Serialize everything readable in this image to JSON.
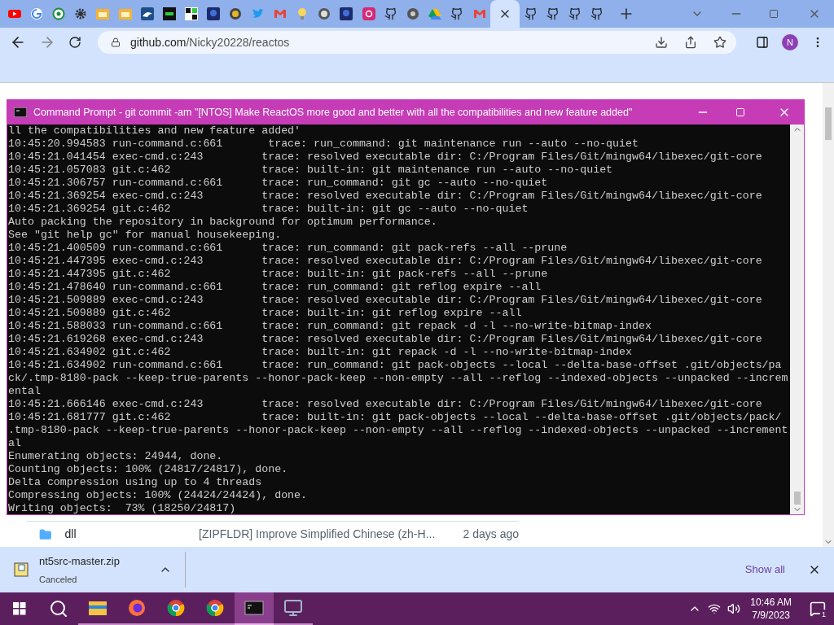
{
  "browser": {
    "tabs": [
      {
        "kind": "youtube",
        "selected": false
      },
      {
        "kind": "google",
        "selected": false
      },
      {
        "kind": "circle-green",
        "selected": false
      },
      {
        "kind": "gear",
        "selected": false
      },
      {
        "kind": "folder",
        "selected": false
      },
      {
        "kind": "folder",
        "selected": false
      },
      {
        "kind": "bird",
        "selected": false
      },
      {
        "kind": "kim",
        "selected": false
      },
      {
        "kind": "squares",
        "selected": false
      },
      {
        "kind": "game",
        "selected": false
      },
      {
        "kind": "circle-gold",
        "selected": false
      },
      {
        "kind": "twitter",
        "selected": false
      },
      {
        "kind": "gmail",
        "selected": false
      },
      {
        "kind": "bulb",
        "selected": false
      },
      {
        "kind": "circle-gray",
        "selected": false
      },
      {
        "kind": "game",
        "selected": false
      },
      {
        "kind": "instagram",
        "selected": false
      },
      {
        "kind": "github",
        "selected": false
      },
      {
        "kind": "chrome",
        "selected": false
      },
      {
        "kind": "drive",
        "selected": false
      },
      {
        "kind": "github",
        "selected": false
      },
      {
        "kind": "gmail",
        "selected": false
      },
      {
        "kind": "close",
        "selected": true
      },
      {
        "kind": "github",
        "selected": false
      },
      {
        "kind": "github",
        "selected": false
      },
      {
        "kind": "github",
        "selected": false
      },
      {
        "kind": "github",
        "selected": false
      }
    ],
    "address": {
      "host": "github.com",
      "path": "/Nicky20228/reactos"
    },
    "profile": "N"
  },
  "console": {
    "title": "Command Prompt - git  commit -am \"[NTOS] Make ReactOS more good and better with all the compatibilities and new feature added\"",
    "lines": [
      "ll the compatibilities and new feature added'",
      "10:45:20.994583 run-command.c:661       trace: run_command: git maintenance run --auto --no-quiet",
      "10:45:21.041454 exec-cmd.c:243         trace: resolved executable dir: C:/Program Files/Git/mingw64/libexec/git-core",
      "10:45:21.057083 git.c:462              trace: built-in: git maintenance run --auto --no-quiet",
      "10:45:21.306757 run-command.c:661      trace: run_command: git gc --auto --no-quiet",
      "10:45:21.369254 exec-cmd.c:243         trace: resolved executable dir: C:/Program Files/Git/mingw64/libexec/git-core",
      "10:45:21.369254 git.c:462              trace: built-in: git gc --auto --no-quiet",
      "Auto packing the repository in background for optimum performance.",
      "See \"git help gc\" for manual housekeeping.",
      "10:45:21.400509 run-command.c:661      trace: run_command: git pack-refs --all --prune",
      "10:45:21.447395 exec-cmd.c:243         trace: resolved executable dir: C:/Program Files/Git/mingw64/libexec/git-core",
      "10:45:21.447395 git.c:462              trace: built-in: git pack-refs --all --prune",
      "10:45:21.478640 run-command.c:661      trace: run_command: git reflog expire --all",
      "10:45:21.509889 exec-cmd.c:243         trace: resolved executable dir: C:/Program Files/Git/mingw64/libexec/git-core",
      "10:45:21.509889 git.c:462              trace: built-in: git reflog expire --all",
      "10:45:21.588033 run-command.c:661      trace: run_command: git repack -d -l --no-write-bitmap-index",
      "10:45:21.619268 exec-cmd.c:243         trace: resolved executable dir: C:/Program Files/Git/mingw64/libexec/git-core",
      "10:45:21.634902 git.c:462              trace: built-in: git repack -d -l --no-write-bitmap-index",
      "10:45:21.634902 run-command.c:661      trace: run_command: git pack-objects --local --delta-base-offset .git/objects/pa",
      "ck/.tmp-8180-pack --keep-true-parents --honor-pack-keep --non-empty --all --reflog --indexed-objects --unpacked --increm",
      "ental",
      "10:45:21.666146 exec-cmd.c:243         trace: resolved executable dir: C:/Program Files/Git/mingw64/libexec/git-core",
      "10:45:21.681777 git.c:462              trace: built-in: git pack-objects --local --delta-base-offset .git/objects/pack/",
      ".tmp-8180-pack --keep-true-parents --honor-pack-keep --non-empty --all --reflog --indexed-objects --unpacked --increment",
      "al",
      "Enumerating objects: 24944, done.",
      "Counting objects: 100% (24817/24817), done.",
      "Delta compression using up to 4 threads",
      "Compressing objects: 100% (24424/24424), done.",
      "Writing objects:  73% (18250/24817)"
    ]
  },
  "file_row": {
    "name": "dll",
    "message": "[ZIPFLDR] Improve Simplified Chinese (zh-H...",
    "age": "2 days ago"
  },
  "download": {
    "file": "nt5src-master.zip",
    "status": "Canceled",
    "show_all": "Show all"
  },
  "taskbar": {
    "apps": [
      {
        "kind": "explorer",
        "selected": false
      },
      {
        "kind": "firefox",
        "selected": false
      },
      {
        "kind": "chrome",
        "selected": false
      },
      {
        "kind": "chrome",
        "selected": false
      },
      {
        "kind": "terminal",
        "selected": true
      },
      {
        "kind": "monitor",
        "selected": false
      }
    ],
    "time": "10:46 AM",
    "date": "7/9/2023",
    "notifications": "1"
  }
}
